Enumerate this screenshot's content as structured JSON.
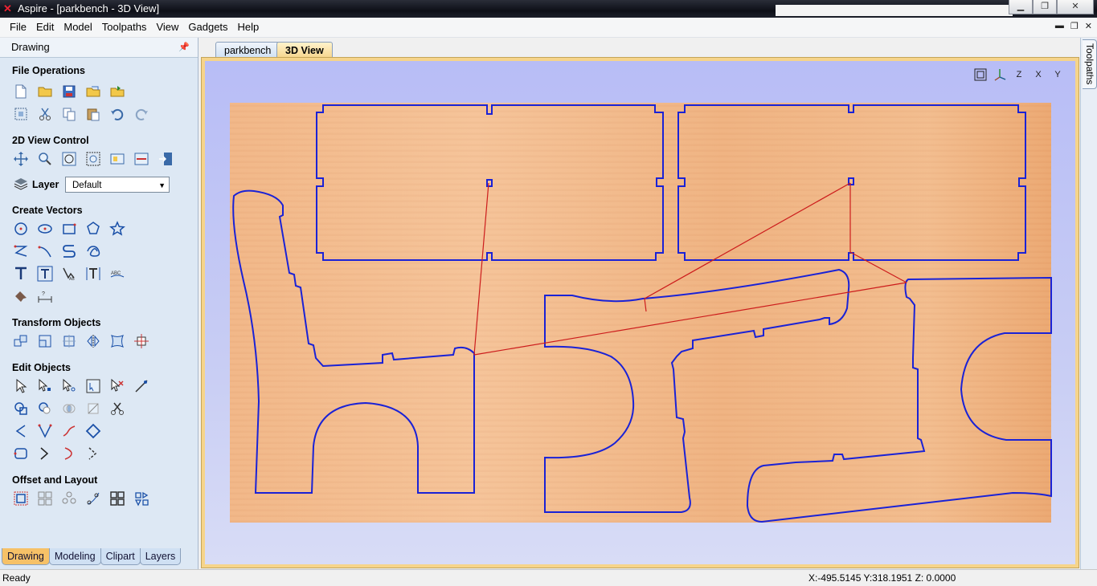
{
  "window": {
    "title": "Aspire - [parkbench - 3D View]"
  },
  "menu": [
    "File",
    "Edit",
    "Model",
    "Toolpaths",
    "View",
    "Gadgets",
    "Help"
  ],
  "left_panel": {
    "header": "Drawing",
    "sections": {
      "file_operations": "File Operations",
      "view_control": "2D View Control",
      "create_vectors": "Create Vectors",
      "transform_objects": "Transform Objects",
      "edit_objects": "Edit Objects",
      "offset_layout": "Offset and Layout"
    },
    "layer": {
      "label": "Layer",
      "selected": "Default"
    },
    "bottom_tabs": [
      "Drawing",
      "Modeling",
      "Clipart",
      "Layers"
    ]
  },
  "doc_tabs": [
    "parkbench",
    "3D View"
  ],
  "active_doc_tab": "3D View",
  "right_panel": {
    "tab": "Toolpaths"
  },
  "view_icons": [
    "fit-view-icon",
    "iso-view-icon",
    "z-view-icon",
    "x-view-icon",
    "y-view-icon"
  ],
  "view_icon_labels": [
    "",
    "",
    "Z",
    "X",
    "Y"
  ],
  "status": {
    "left": "Ready",
    "coords": "X:-495.5145 Y:318.1951  Z:  0.0000"
  },
  "colors": {
    "vector": "#1a22d6",
    "toolpath_link": "#cc1c1c",
    "material": "#f2bd8f",
    "view_bg": "#c8cdf4"
  }
}
